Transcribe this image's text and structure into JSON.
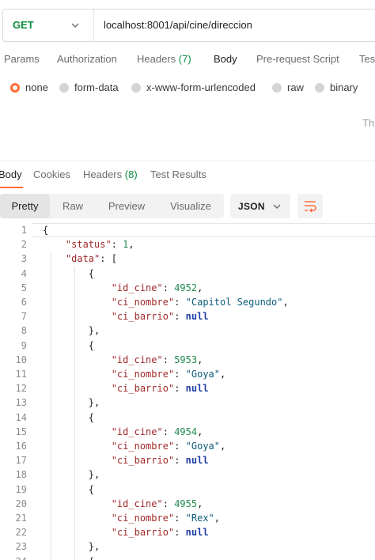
{
  "request": {
    "method": "GET",
    "url": "localhost:8001/api/cine/direccion"
  },
  "request_tabs": [
    {
      "label": "Params"
    },
    {
      "label": "Authorization"
    },
    {
      "label": "Headers",
      "count": "(7)"
    },
    {
      "label": "Body",
      "active": true
    },
    {
      "label": "Pre-request Script"
    },
    {
      "label": "Tes"
    }
  ],
  "body_types": [
    {
      "label": "none",
      "selected": true
    },
    {
      "label": "form-data"
    },
    {
      "label": "x-www-form-urlencoded"
    },
    {
      "label": "raw"
    },
    {
      "label": "binary"
    }
  ],
  "truncated_hint": "Th",
  "response_tabs": [
    {
      "label": "Body",
      "active": true
    },
    {
      "label": "Cookies"
    },
    {
      "label": "Headers",
      "count": "(8)"
    },
    {
      "label": "Test Results"
    }
  ],
  "view_modes": [
    "Pretty",
    "Raw",
    "Preview",
    "Visualize"
  ],
  "active_view": "Pretty",
  "format": "JSON",
  "accent_color": "#ff6c37",
  "icons": {
    "method_dropdown": "chevron-down-icon",
    "format_dropdown": "chevron-down-icon",
    "wrap": "wrap-lines-icon"
  },
  "code_lines": [
    "{",
    "    \"status\": 1,",
    "    \"data\": [",
    "        {",
    "            \"id_cine\": 4952,",
    "            \"ci_nombre\": \"Capitol Segundo\",",
    "            \"ci_barrio\": null",
    "        },",
    "        {",
    "            \"id_cine\": 5953,",
    "            \"ci_nombre\": \"Goya\",",
    "            \"ci_barrio\": null",
    "        },",
    "        {",
    "            \"id_cine\": 4954,",
    "            \"ci_nombre\": \"Goya\",",
    "            \"ci_barrio\": null",
    "        },",
    "        {",
    "            \"id_cine\": 4955,",
    "            \"ci_nombre\": \"Rex\",",
    "            \"ci_barrio\": null",
    "        },",
    "        {"
  ]
}
